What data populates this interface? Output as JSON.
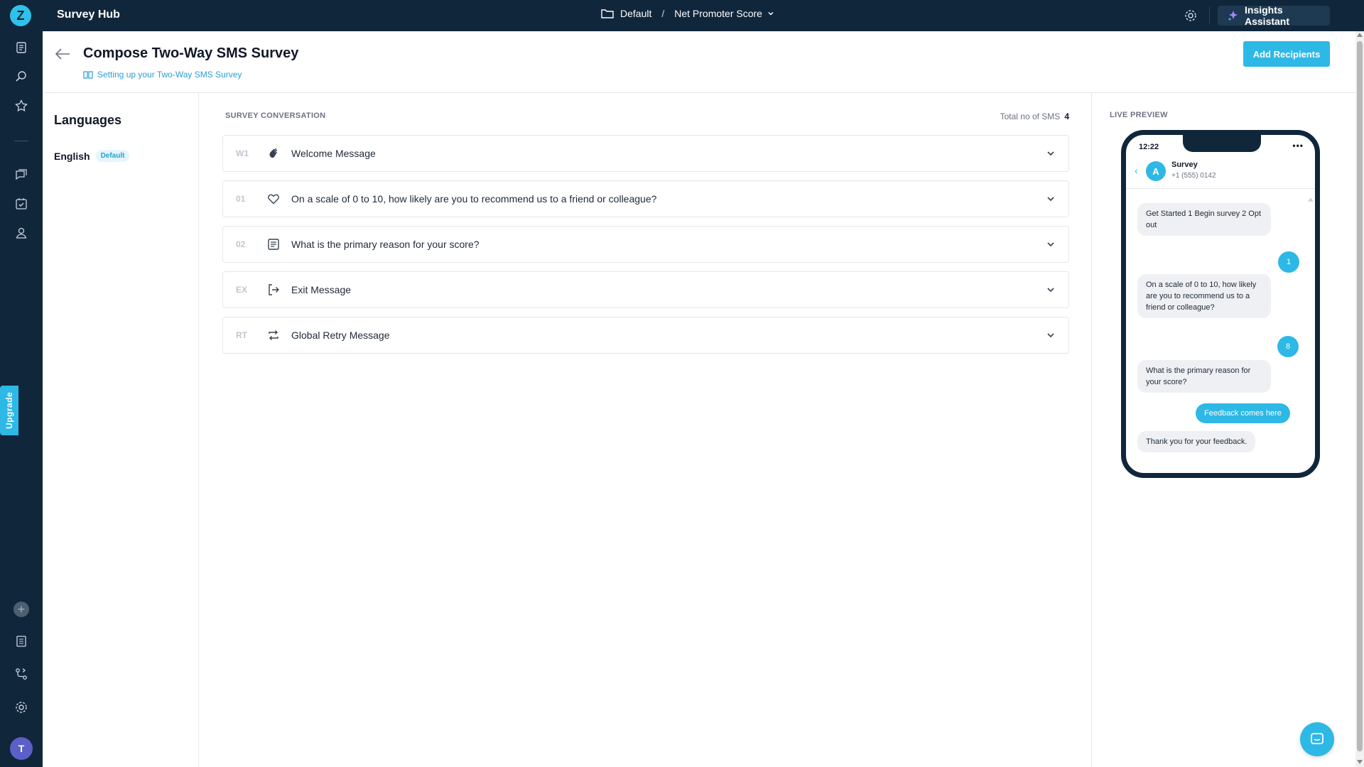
{
  "app": {
    "logo_letter": "Z",
    "title": "Survey Hub"
  },
  "breadcrumb": {
    "folder": "Default",
    "separator": "/",
    "survey": "Net Promoter Score"
  },
  "topbar": {
    "insights_label": "Insights Assistant"
  },
  "rail": {
    "icons": [
      "surveys-icon",
      "search-insights-icon",
      "star-icon",
      "chat-icon",
      "tasks-icon",
      "user-icon",
      "add-icon",
      "library-icon",
      "integrations-icon",
      "settings-icon"
    ],
    "avatar_letter": "T",
    "upgrade_label": "Upgrade"
  },
  "header": {
    "title": "Compose Two-Way SMS Survey",
    "help_link": "Setting up your Two-Way SMS Survey",
    "add_recipients_label": "Add Recipients"
  },
  "languages": {
    "heading": "Languages",
    "items": [
      {
        "name": "English",
        "badge": "Default"
      }
    ]
  },
  "conversation": {
    "label": "SURVEY CONVERSATION",
    "total_label": "Total no of SMS",
    "total_value": "4",
    "rows": [
      {
        "code": "W1",
        "icon": "wave-hand-icon",
        "text": "Welcome Message"
      },
      {
        "code": "01",
        "icon": "heart-icon",
        "text": "On a scale of 0 to 10, how likely are you to recommend us to a friend or colleague?"
      },
      {
        "code": "02",
        "icon": "text-box-icon",
        "text": "What is the primary reason for your score?"
      },
      {
        "code": "EX",
        "icon": "exit-icon",
        "text": "Exit Message"
      },
      {
        "code": "RT",
        "icon": "retry-icon",
        "text": "Global Retry Message"
      }
    ]
  },
  "preview": {
    "label": "LIVE PREVIEW",
    "time": "12:22",
    "dots": "•••",
    "contact_initial": "A",
    "contact_name": "Survey",
    "contact_number": "+1 (555) 0142",
    "messages": [
      {
        "dir": "in",
        "text": "Get Started 1 Begin survey 2 Opt out"
      },
      {
        "dir": "out",
        "text": "1"
      },
      {
        "dir": "in",
        "text": "On a scale of 0 to 10, how likely are you to recommend us to a friend or colleague?"
      },
      {
        "dir": "out",
        "text": "8"
      },
      {
        "dir": "in",
        "text": "What is the primary reason for your score?"
      },
      {
        "dir": "out",
        "text": "Feedback comes here"
      },
      {
        "dir": "in",
        "text": "Thank you for your feedback."
      }
    ]
  },
  "colors": {
    "navy": "#10263b",
    "accent": "#2eb8e6"
  }
}
